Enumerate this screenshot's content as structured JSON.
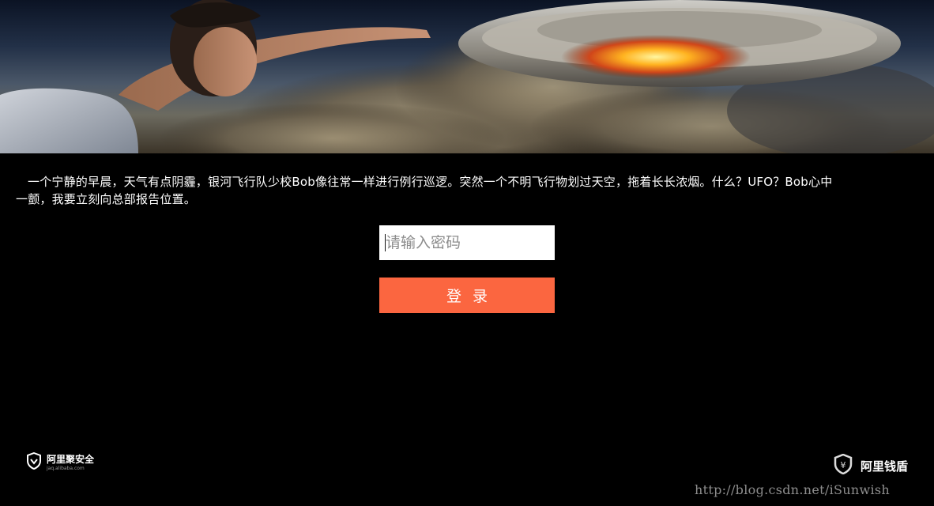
{
  "banner": {
    "alt": ""
  },
  "story": {
    "text": "一个宁静的早晨，天气有点阴霾，银河飞行队少校Bob像往常一样进行例行巡逻。突然一个不明飞行物划过天空，拖着长长浓烟。什么？UFO？Bob心中一颤，我要立刻向总部报告位置。"
  },
  "form": {
    "password_placeholder": "请输入密码",
    "login_label": "登录"
  },
  "footer": {
    "left_brand": "阿里聚安全",
    "left_url": "jaq.alibaba.com",
    "right_brand": "阿里钱盾",
    "watermark": "http://blog.csdn.net/iSunwish"
  },
  "colors": {
    "background": "#000000",
    "accent": "#fb6640",
    "text": "#ffffff"
  },
  "icons": {
    "left_logo": "shield-icon",
    "right_logo": "shield-yen-icon"
  }
}
